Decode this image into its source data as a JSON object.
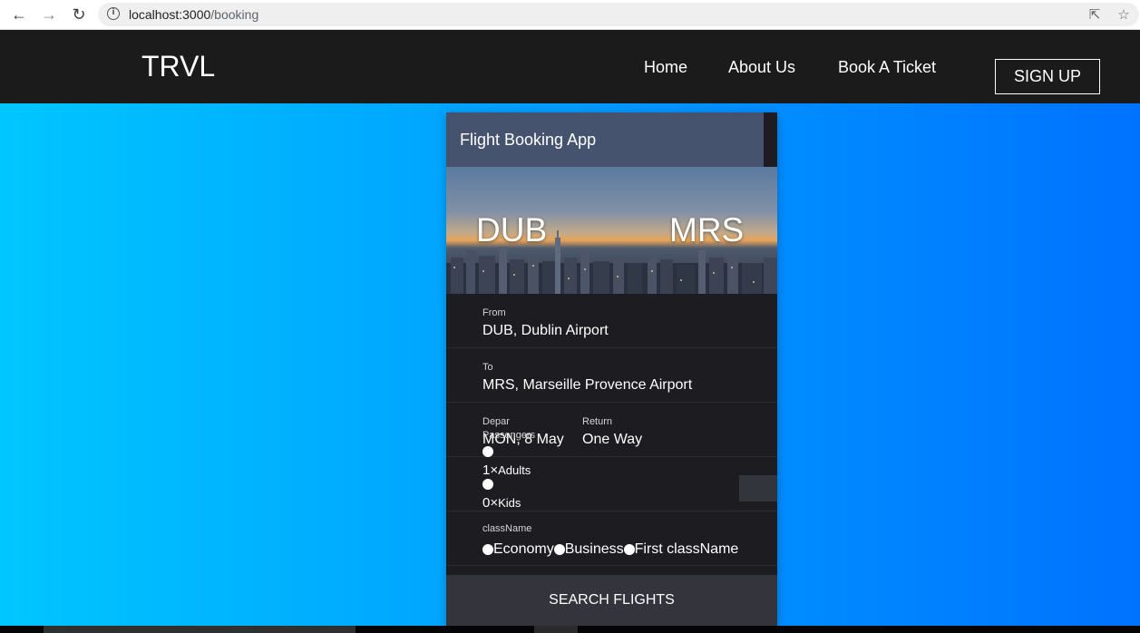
{
  "browser": {
    "url_host": "localhost:3000",
    "url_path": "/booking",
    "back_icon": "arrow-left-icon",
    "forward_icon": "arrow-right-icon",
    "reload_icon": "reload-icon",
    "info_icon": "info-icon",
    "share_icon": "share-icon",
    "bookmark_icon": "star-icon"
  },
  "header": {
    "logo": "TRVL",
    "nav": [
      "Home",
      "About Us",
      "Book A Ticket"
    ],
    "signup_label": "SIGN UP"
  },
  "colors": {
    "header_bg": "#1c1b1c",
    "gradient_start": "#00c6ff",
    "gradient_end": "#0072ff",
    "card_bg": "#1d1d21",
    "card_head_bg": "#45536f"
  },
  "card": {
    "title": "Flight Booking App",
    "from_code": "DUB",
    "to_code": "MRS",
    "from": {
      "label": "From",
      "value": "DUB, Dublin Airport"
    },
    "to": {
      "label": "To",
      "value": "MRS, Marseille Provence Airport"
    },
    "depart": {
      "label": "Depar",
      "value": "MON, 8 May"
    },
    "return": {
      "label": "Return",
      "value": "One Way"
    },
    "passengers": {
      "label": "Passengers",
      "adults_count": "1",
      "adults_label": "Adults",
      "kids_count": "0",
      "kids_label": "Kids",
      "times": "×"
    },
    "class": {
      "label": "className",
      "options": [
        "Economy",
        "Business",
        "First className"
      ]
    },
    "search_label": "SEARCH FLIGHTS"
  }
}
